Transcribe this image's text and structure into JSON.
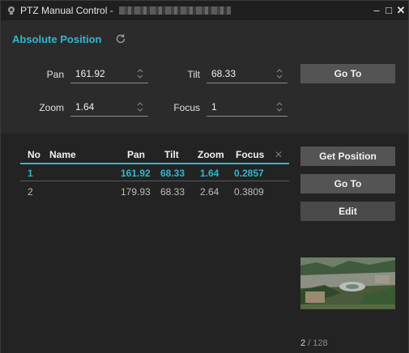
{
  "window": {
    "title": "PTZ Manual Control -",
    "controls": {
      "minimize": "‒",
      "maximize": "□",
      "close": "✕"
    }
  },
  "absolute": {
    "section_title": "Absolute Position",
    "pan_label": "Pan",
    "pan_value": "161.92",
    "tilt_label": "Tilt",
    "tilt_value": "68.33",
    "zoom_label": "Zoom",
    "zoom_value": "1.64",
    "focus_label": "Focus",
    "focus_value": "1",
    "goto_label": "Go To"
  },
  "presets": {
    "columns": [
      "No",
      "Name",
      "Pan",
      "Tilt",
      "Zoom",
      "Focus"
    ],
    "clear_glyph": "✕",
    "rows": [
      {
        "no": "1",
        "name": "",
        "pan": "161.92",
        "tilt": "68.33",
        "zoom": "1.64",
        "focus": "0.2857",
        "selected": true
      },
      {
        "no": "2",
        "name": "",
        "pan": "179.93",
        "tilt": "68.33",
        "zoom": "2.64",
        "focus": "0.3809",
        "selected": false
      }
    ],
    "get_position_label": "Get Position",
    "goto_label": "Go To",
    "edit_label": "Edit"
  },
  "pager": {
    "current": "2",
    "separator": " / ",
    "total": "128"
  },
  "colors": {
    "accent": "#32b6cf",
    "button": "#545454",
    "panel": "#2b2b2b",
    "list_bg": "#232323"
  },
  "icons": {
    "title": "camera-icon",
    "refresh": "refresh-icon",
    "spin": "spin-arrows-icon"
  }
}
